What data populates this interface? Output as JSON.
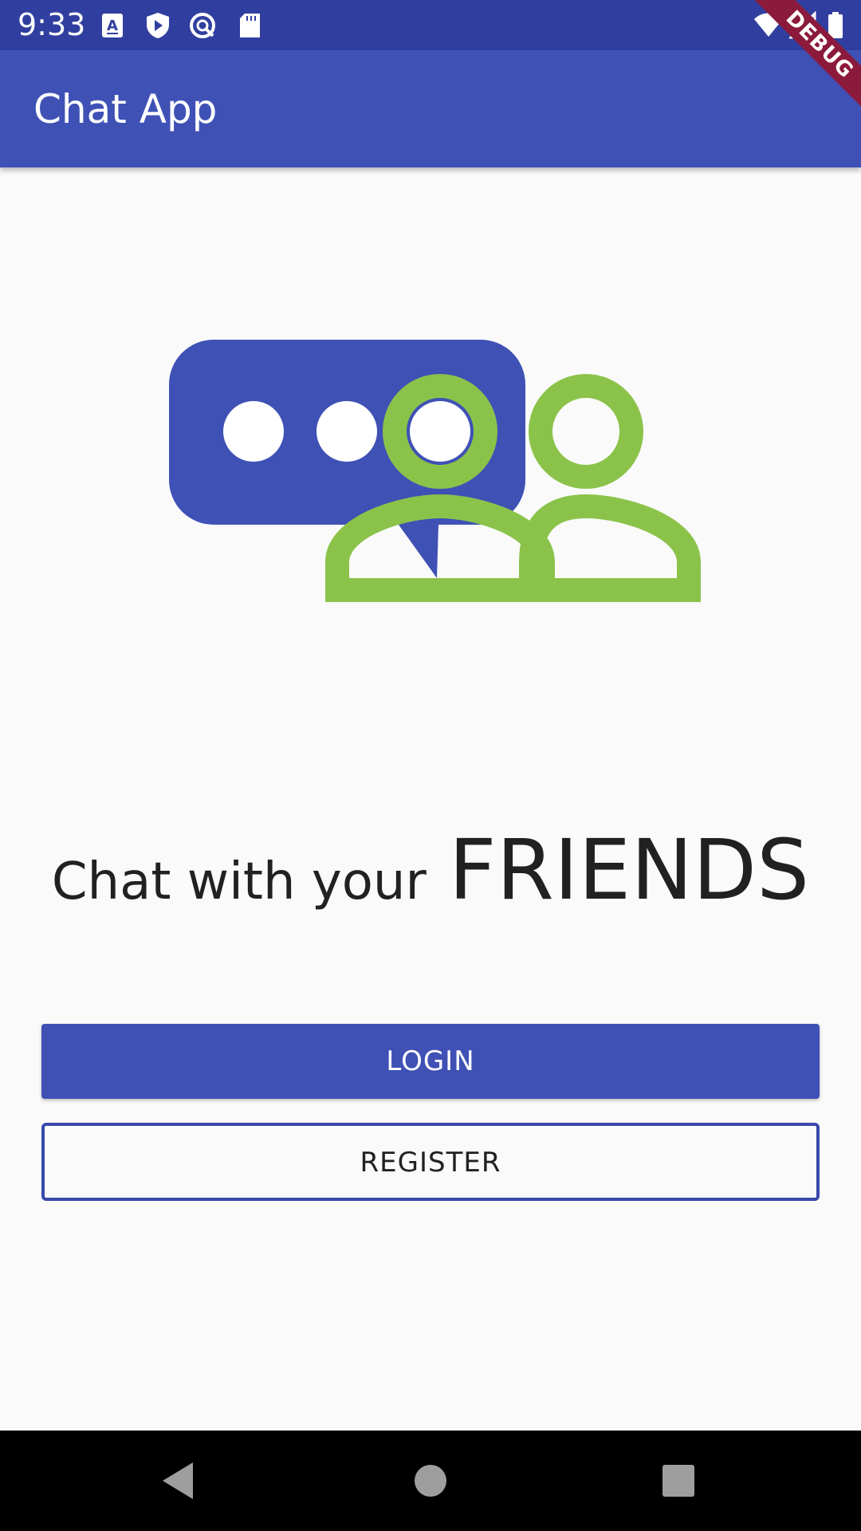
{
  "status_bar": {
    "time": "9:33",
    "icons": [
      "keyboard-a-icon",
      "play-protect-icon",
      "sync-icon",
      "sd-card-icon",
      "wifi-icon",
      "cell-signal-icon",
      "battery-icon"
    ]
  },
  "app_bar": {
    "title": "Chat App"
  },
  "debug_banner": {
    "label": "DEBUG"
  },
  "illustration": {
    "name": "chat-friends-illustration",
    "colors": {
      "bubble": "#3f51b5",
      "people": "#8bc34a",
      "dots": "#ffffff"
    }
  },
  "tagline": {
    "prefix": "Chat with your",
    "emphasis": "FRIENDS"
  },
  "buttons": {
    "login": "LOGIN",
    "register": "REGISTER"
  },
  "nav_bar": {
    "icons": [
      "back-icon",
      "home-icon",
      "recents-icon"
    ]
  },
  "colors": {
    "primary": "#3f51b5",
    "primary_dark": "#303f9f",
    "accent_green": "#8bc34a",
    "background": "#fafafa",
    "text": "#212121"
  }
}
